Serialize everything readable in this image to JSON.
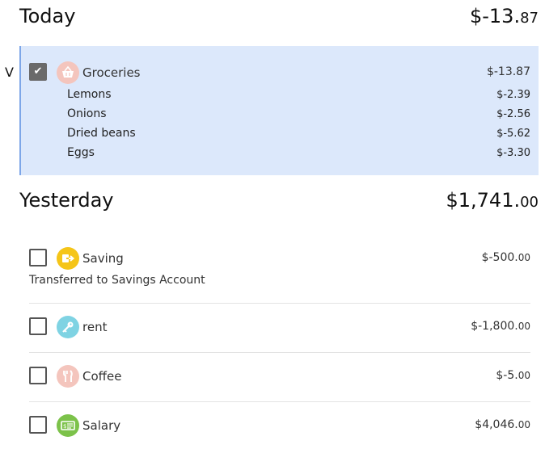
{
  "today": {
    "title": "Today",
    "total_main": "$-13.",
    "total_cents": "87"
  },
  "yesterday": {
    "title": "Yesterday",
    "total_main": "$1,741.",
    "total_cents": "00"
  },
  "expand_marker": "V",
  "groceries": {
    "name": "Groceries",
    "amount": "$-13.87",
    "icon": "basket-icon",
    "icon_color": "#f4c5bd",
    "checked": true,
    "items": [
      {
        "name": "Lemons",
        "amount": "$-2.39"
      },
      {
        "name": "Onions",
        "amount": "$-2.56"
      },
      {
        "name": "Dried beans",
        "amount": "$-5.62"
      },
      {
        "name": "Eggs",
        "amount": "$-3.30"
      }
    ]
  },
  "transactions": [
    {
      "name": "Saving",
      "amount_main": "$-500.",
      "amount_cents": "00",
      "icon": "transfer-icon",
      "icon_color": "#f5c518",
      "note": "Transferred to Savings Account"
    },
    {
      "name": "rent",
      "amount_main": "$-1,800.",
      "amount_cents": "00",
      "icon": "key-icon",
      "icon_color": "#7fd3e3"
    },
    {
      "name": "Coffee",
      "amount_main": "$-5.",
      "amount_cents": "00",
      "icon": "fork-knife-icon",
      "icon_color": "#f4c5bd"
    },
    {
      "name": "Salary",
      "amount_main": "$4,046.",
      "amount_cents": "00",
      "icon": "money-icon",
      "icon_color": "#7cc24a"
    }
  ]
}
